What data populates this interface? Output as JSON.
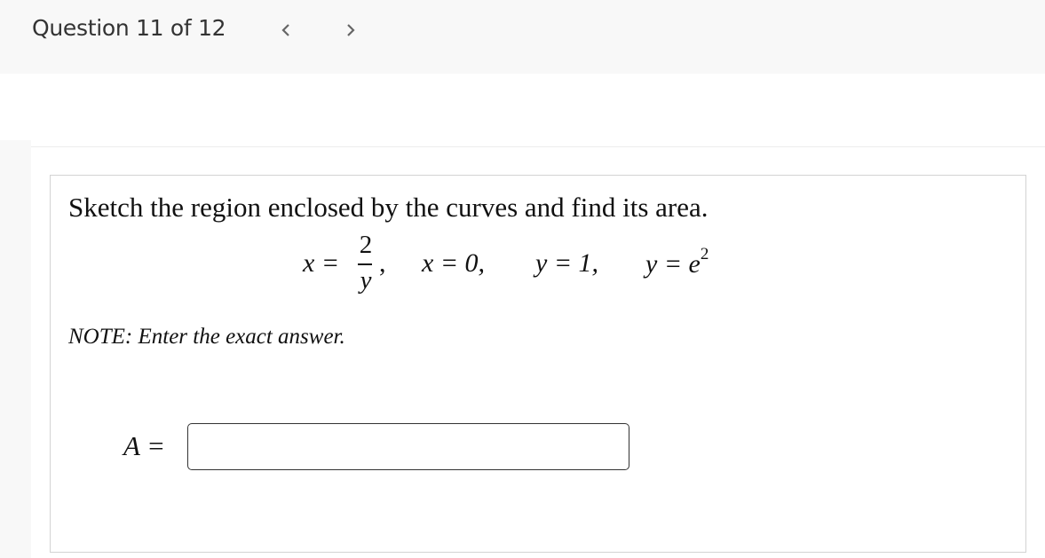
{
  "header": {
    "question_counter": "Question 11 of 12",
    "prev_icon": "chevron-left-icon",
    "next_icon": "chevron-right-icon",
    "prev_glyph": "<",
    "next_glyph": ">"
  },
  "question": {
    "prompt": "Sketch the region enclosed by the curves and find its area.",
    "equation": {
      "curve1_lhs": "x = ",
      "curve1_numerator": "2",
      "curve1_denominator": "y",
      "sep1": ",",
      "curve2": "x = 0,",
      "curve3": "y = 1,",
      "curve4_base": "y = e",
      "curve4_exponent": "2"
    },
    "note": "NOTE: Enter the exact answer.",
    "answer": {
      "label": "A =",
      "value": "",
      "placeholder": ""
    }
  }
}
